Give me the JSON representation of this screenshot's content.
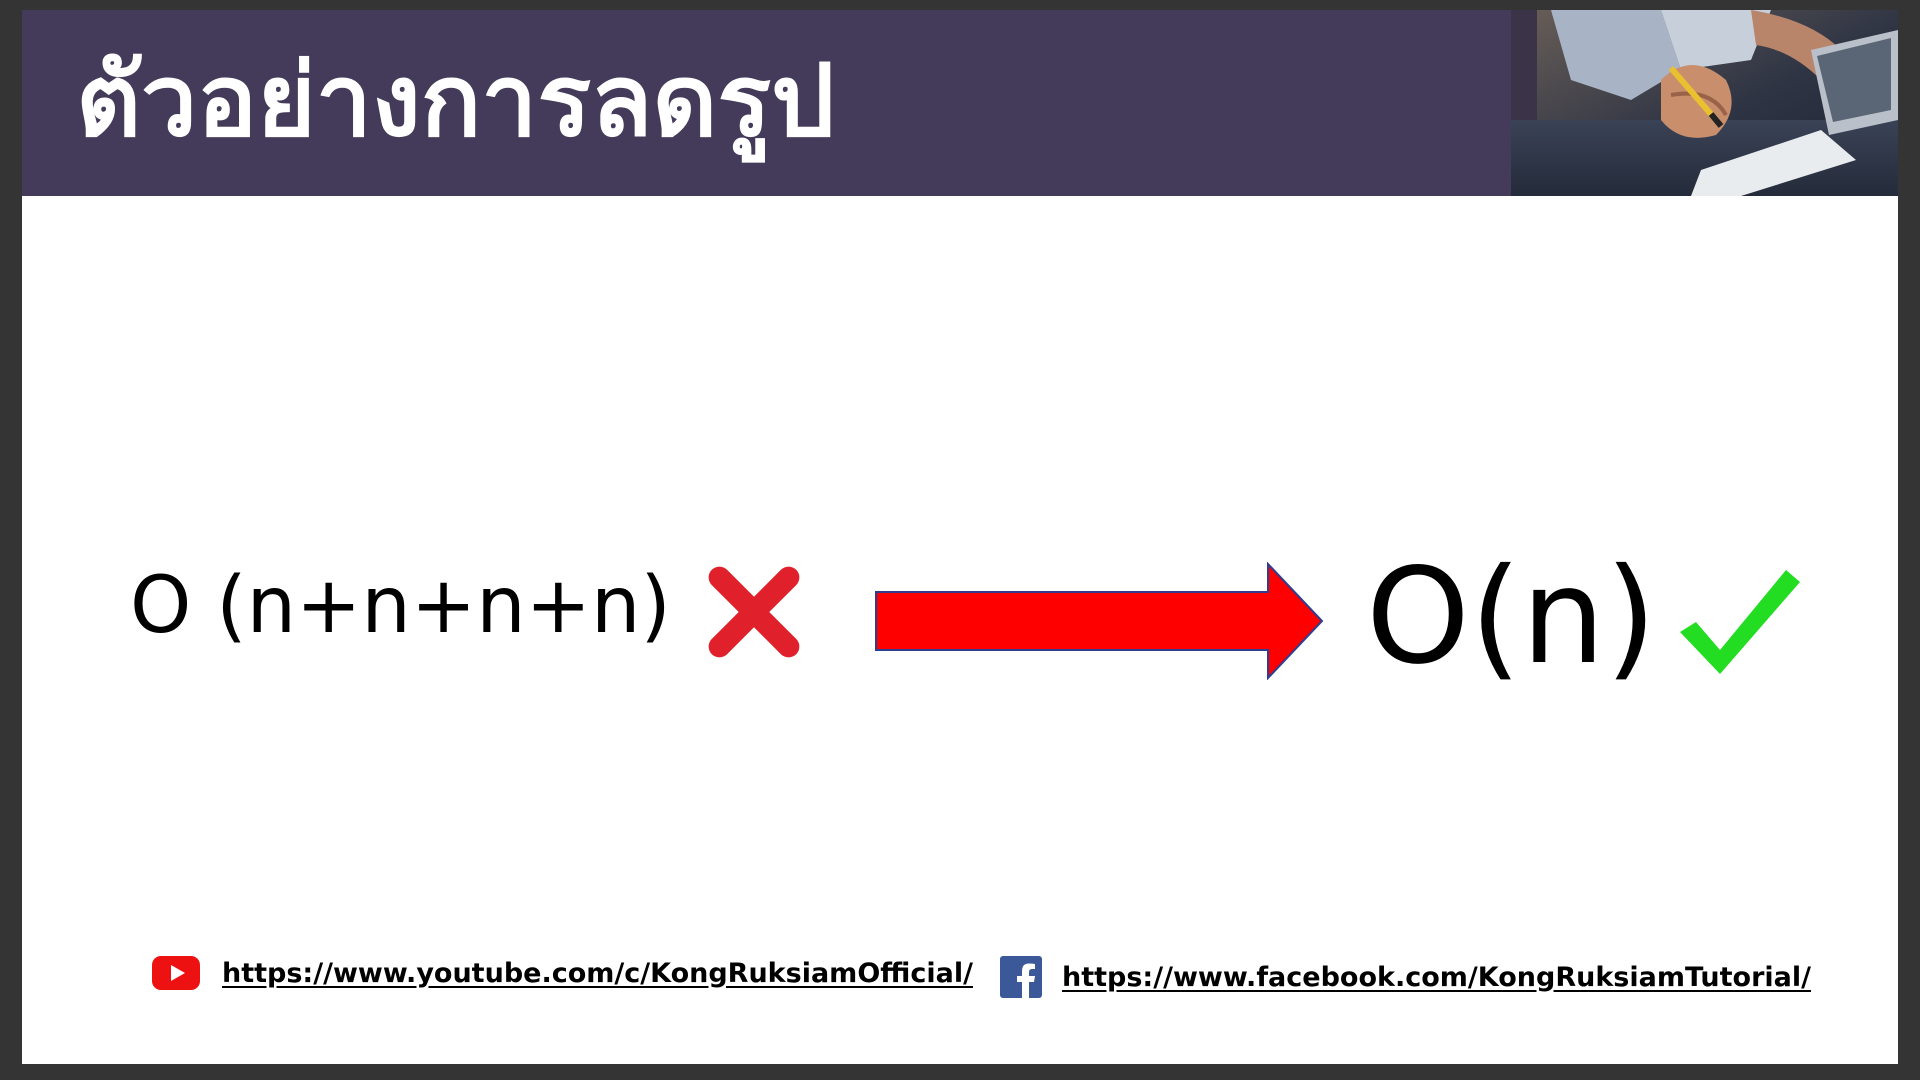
{
  "slide": {
    "title": "ตัวอย่างการลดรูป",
    "header_photo": "person-writing-at-desk-photo"
  },
  "content": {
    "before_expression": "O (n+n+n+n)",
    "before_status_icon": "red-cross-icon",
    "transform_icon": "right-arrow-icon",
    "after_expression": "O(n)",
    "after_status_icon": "green-check-icon"
  },
  "footer": {
    "youtube_url": "https://www.youtube.com/c/KongRuksiamOfficial/",
    "facebook_url": "https://www.facebook.com/KongRuksiamTutorial/"
  },
  "colors": {
    "title_bar": "#443a5a",
    "arrow_fill": "#ff0000",
    "arrow_outline": "#2e3d8f",
    "cross": "#e0202a",
    "check": "#22dd22",
    "youtube_red": "#ee1111",
    "facebook_blue": "#3b5998"
  }
}
